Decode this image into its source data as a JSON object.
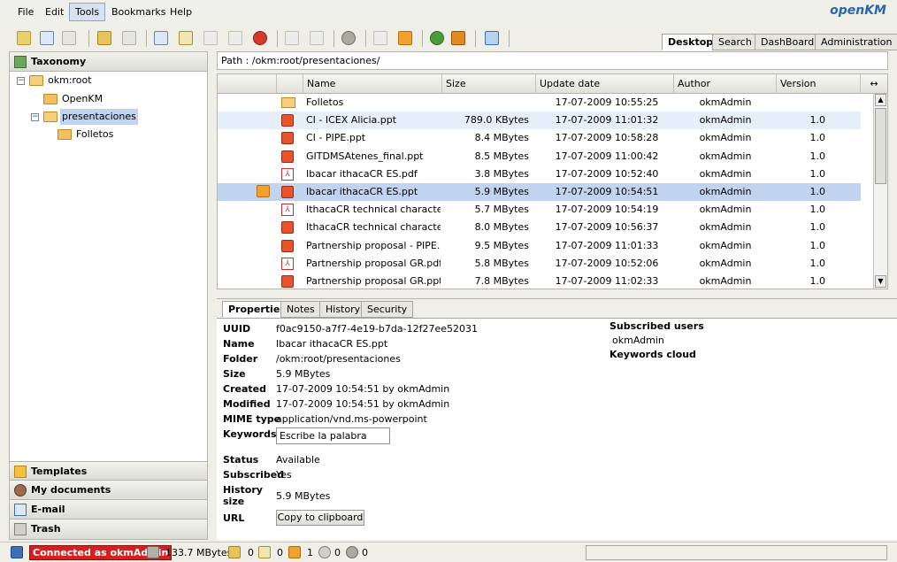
{
  "menu": {
    "items": [
      "File",
      "Edit",
      "Tools",
      "Bookmarks",
      "Help"
    ],
    "active": "Tools"
  },
  "logo": "openKM",
  "toolbar": {
    "icons": [
      "add-folder-icon",
      "add-document-icon",
      "find-icon",
      "lock-icon",
      "unlock-icon",
      "add-doc-icon",
      "edit-icon",
      "checkin-icon",
      "cancel-checkout-icon",
      "delete-icon",
      "copy-icon",
      "move-icon",
      "settings-icon",
      "add-subscription-icon",
      "remove-subscription-icon",
      "refresh-icon",
      "home-icon",
      "scanner-icon"
    ],
    "colors": {
      "green": "#4a9e3a",
      "orange": "#e38a1f",
      "blue": "#3b6fb6",
      "red": "#d23a2a",
      "grey": "#b8b8b0"
    }
  },
  "workspace_tabs": [
    "Desktop",
    "Search",
    "DashBoard",
    "Administration"
  ],
  "left": {
    "taxonomy_title": "Taxonomy",
    "tree": [
      {
        "label": "okm:root",
        "level": 0,
        "toggle": "−"
      },
      {
        "label": "OpenKM",
        "level": 1,
        "toggle": ""
      },
      {
        "label": "presentaciones",
        "level": 1,
        "toggle": "−"
      },
      {
        "label": "Folletos",
        "level": 2,
        "toggle": ""
      }
    ],
    "stacks": [
      "Templates",
      "My documents",
      "E-mail",
      "Trash"
    ]
  },
  "path": "Path : /okm:root/presentaciones/",
  "filelist": {
    "headers": [
      "Name",
      "Size",
      "Update date",
      "Author",
      "Version"
    ],
    "rows": [
      {
        "type": "folder",
        "name": "Folletos",
        "size": "",
        "date": "17-07-2009 10:55:25",
        "author": "okmAdmin",
        "version": ""
      },
      {
        "type": "ppt",
        "name": "CI - ICEX Alicia.ppt",
        "size": "789.0 KBytes",
        "date": "17-07-2009 11:01:32",
        "author": "okmAdmin",
        "version": "1.0"
      },
      {
        "type": "ppt",
        "name": "CI - PIPE.ppt",
        "size": "8.4 MBytes",
        "date": "17-07-2009 10:58:28",
        "author": "okmAdmin",
        "version": "1.0"
      },
      {
        "type": "ppt",
        "name": "GITDMSAtenes_final.ppt",
        "size": "8.5 MBytes",
        "date": "17-07-2009 11:00:42",
        "author": "okmAdmin",
        "version": "1.0"
      },
      {
        "type": "pdf",
        "name": "Ibacar ithacaCR ES.pdf",
        "size": "3.8 MBytes",
        "date": "17-07-2009 10:52:40",
        "author": "okmAdmin",
        "version": "1.0"
      },
      {
        "type": "ppt",
        "name": "Ibacar ithacaCR ES.ppt",
        "size": "5.9 MBytes",
        "date": "17-07-2009 10:54:51",
        "author": "okmAdmin",
        "version": "1.0"
      },
      {
        "type": "pdf",
        "name": "IthacaCR technical characteristics",
        "size": "5.7 MBytes",
        "date": "17-07-2009 10:54:19",
        "author": "okmAdmin",
        "version": "1.0"
      },
      {
        "type": "ppt",
        "name": "IthacaCR technical characteristics",
        "size": "8.0 MBytes",
        "date": "17-07-2009 10:56:37",
        "author": "okmAdmin",
        "version": "1.0"
      },
      {
        "type": "ppt",
        "name": "Partnership proposal - PIPE.ppt",
        "size": "9.5 MBytes",
        "date": "17-07-2009 11:01:33",
        "author": "okmAdmin",
        "version": "1.0"
      },
      {
        "type": "pdf",
        "name": "Partnership proposal GR.pdf",
        "size": "5.8 MBytes",
        "date": "17-07-2009 10:52:06",
        "author": "okmAdmin",
        "version": "1.0"
      },
      {
        "type": "ppt",
        "name": "Partnership proposal GR.ppt",
        "size": "7.8 MBytes",
        "date": "17-07-2009 11:02:33",
        "author": "okmAdmin",
        "version": "1.0"
      }
    ],
    "selected_index": 5,
    "alt_index": 1
  },
  "properties": {
    "tabs": [
      "Properties",
      "Notes",
      "History",
      "Security"
    ],
    "labels": {
      "uuid": "UUID",
      "name": "Name",
      "folder": "Folder",
      "size": "Size",
      "created": "Created",
      "modified": "Modified",
      "mime": "MIME type",
      "keywords": "Keywords",
      "status": "Status",
      "subscribed": "Subscribed",
      "history_size_1": "History",
      "history_size_2": "size",
      "url": "URL"
    },
    "values": {
      "uuid": "f0ac9150-a7f7-4e19-b7da-12f27ee52031",
      "name": "Ibacar ithacaCR ES.ppt",
      "folder": "/okm:root/presentaciones",
      "size": "5.9 MBytes",
      "created": "17-07-2009 10:54:51 by okmAdmin",
      "modified": "17-07-2009 10:54:51 by okmAdmin",
      "mime": "application/vnd.ms-powerpoint",
      "keywords_placeholder": "Escribe la palabra",
      "status": "Available",
      "subscribed": "Yes",
      "history_size": "5.9 MBytes",
      "copy_button": "Copy to clipboard"
    },
    "subscribed_users_title": "Subscribed users",
    "subscribed_user": "okmAdmin",
    "keywords_cloud_title": "Keywords cloud"
  },
  "status": {
    "connected": "Connected as okmAdmin",
    "usage": "133.7 MBytes",
    "counts": [
      "0",
      "0",
      "1",
      "0",
      "0"
    ]
  }
}
